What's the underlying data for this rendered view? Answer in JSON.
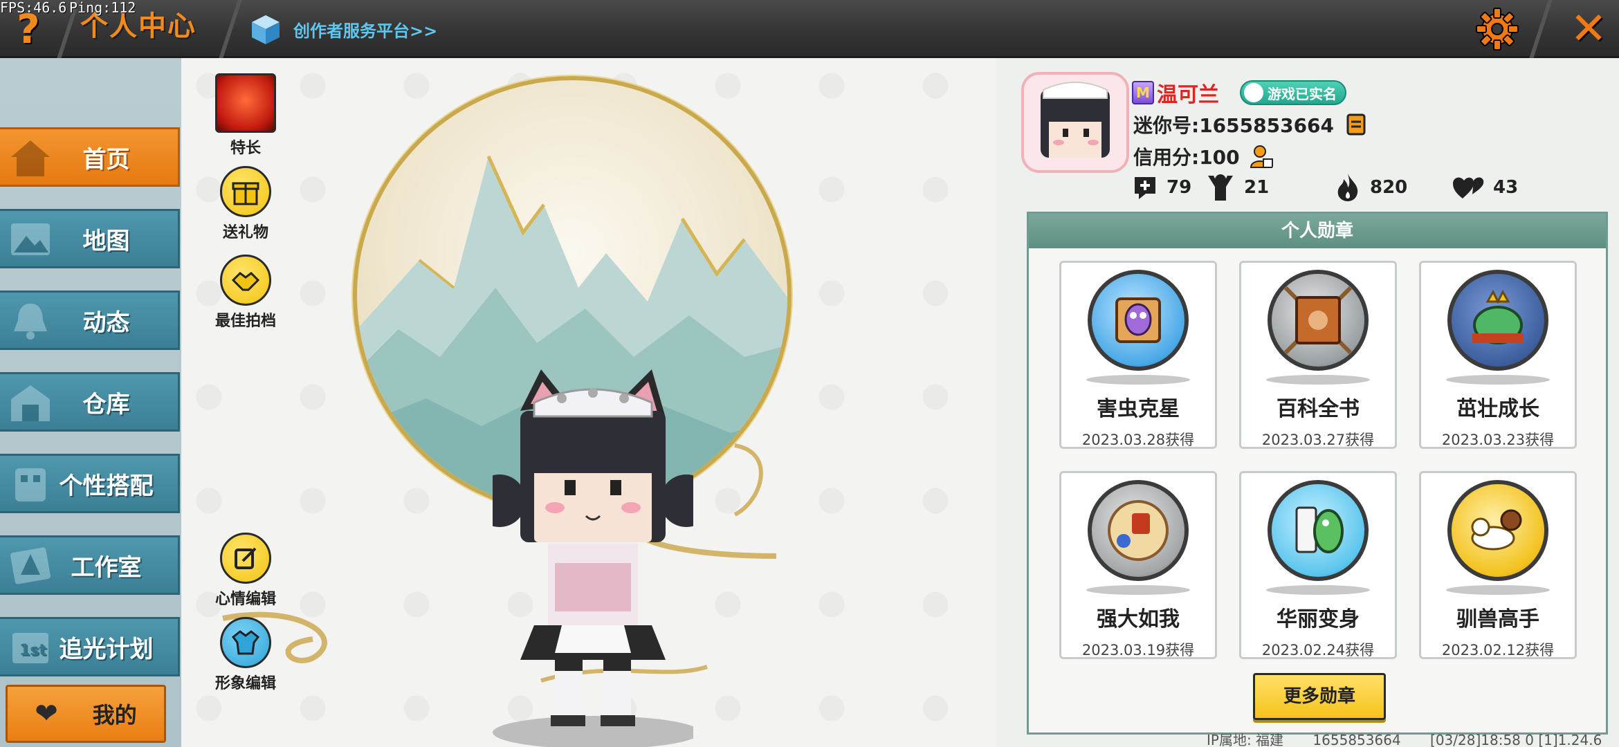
{
  "overlay": {
    "fps_line": "FPS:46.6",
    "ping_line": "Ping:112"
  },
  "topbar": {
    "help_label": "?",
    "title": "个人中心",
    "creator_link": "创作者服务平台>>",
    "close_label": "✕"
  },
  "sidebar": {
    "items": [
      {
        "label": "首页",
        "icon": "house-icon",
        "active": true
      },
      {
        "label": "地图",
        "icon": "picture-icon",
        "active": false
      },
      {
        "label": "动态",
        "icon": "bell-icon",
        "active": false
      },
      {
        "label": "仓库",
        "icon": "warehouse-icon",
        "active": false
      },
      {
        "label": "个性搭配",
        "icon": "outfit-icon",
        "active": false
      },
      {
        "label": "工作室",
        "icon": "studio-icon",
        "active": false
      },
      {
        "label": "追光计划",
        "icon": "plan-icon",
        "active": false
      }
    ],
    "mine_label": "我的"
  },
  "actions": {
    "specialty": "特长",
    "send_gift": "送礼物",
    "best_partner": "最佳拍档",
    "mood_edit": "心情编辑",
    "image_edit": "形象编辑"
  },
  "profile": {
    "vip_mark": "M",
    "username": "温可兰",
    "verified_label": "游戏已实名",
    "mini_id_label": "迷你号:1655853664",
    "credit_label": "信用分:100",
    "stats": {
      "posts": "79",
      "fans": "21",
      "popularity": "820",
      "likes": "43"
    }
  },
  "medals": {
    "header": "个人勋章",
    "items": [
      {
        "name": "害虫克星",
        "date": "2023.03.28获得",
        "color": "#4aa9e8"
      },
      {
        "name": "百科全书",
        "date": "2023.03.27获得",
        "color": "#9aa0a3"
      },
      {
        "name": "茁壮成长",
        "date": "2023.03.23获得",
        "color": "#3d5f9e"
      },
      {
        "name": "强大如我",
        "date": "2023.03.19获得",
        "color": "#a3a7a8"
      },
      {
        "name": "华丽变身",
        "date": "2023.02.24获得",
        "color": "#5cc6ee"
      },
      {
        "name": "驯兽高手",
        "date": "2023.02.12获得",
        "color": "#f3c21e"
      }
    ],
    "more_label": "更多勋章"
  },
  "footer": {
    "ip_location": "IP属地: 福建",
    "uid": "1655853664",
    "timestamp": "[03/28]18:58 0 [1]1.24.6"
  },
  "colors": {
    "accent_orange": "#f28a1e",
    "nav_blue": "#3b7f95",
    "username_red": "#e02424",
    "panel_green": "#6f9c92"
  }
}
